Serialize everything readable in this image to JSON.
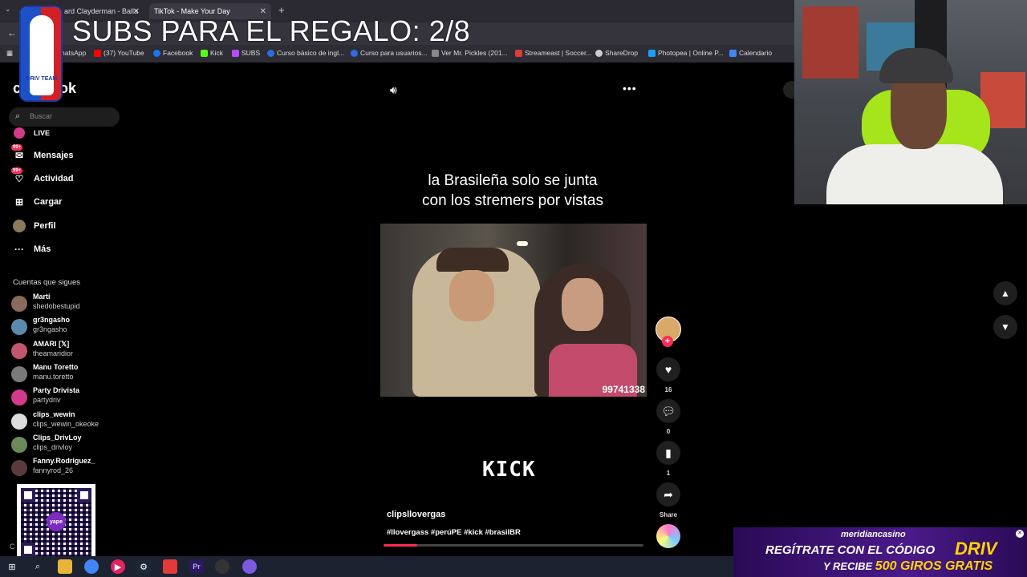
{
  "overlay": {
    "title": "SUBS PARA EL REGALO: 2/8",
    "logo_text": "DRIV TEAM"
  },
  "browser": {
    "tabs": [
      {
        "label": "ard Clayderman - Balla"
      },
      {
        "label": "TikTok - Make Your Day"
      }
    ],
    "new_tab": "+",
    "bookmarks": [
      {
        "label": "hatsApp",
        "color": "#25d366"
      },
      {
        "label": "(37) YouTube",
        "color": "#ff0000"
      },
      {
        "label": "Facebook",
        "color": "#1877f2"
      },
      {
        "label": "Kick",
        "color": "#53fc18"
      },
      {
        "label": "SUBS",
        "color": "#b44cff"
      },
      {
        "label": "Curso básico de ingl...",
        "color": "#2d6cdf"
      },
      {
        "label": "Curso para usuarios...",
        "color": "#2d6cdf"
      },
      {
        "label": "Ver Mr. Pickles (201...",
        "color": "#888888"
      },
      {
        "label": "Streameast | Soccer...",
        "color": "#e03a3a"
      },
      {
        "label": "ShareDrop",
        "color": "#cccccc"
      },
      {
        "label": "Photopea | Online P...",
        "color": "#18a0fb"
      },
      {
        "label": "Calendario",
        "color": "#4285f4"
      }
    ]
  },
  "sidebar": {
    "brand": "ok",
    "search_placeholder": "Buscar",
    "nav": [
      {
        "label": "LIVE",
        "badge": "",
        "icon": "live-icon"
      },
      {
        "label": "Mensajes",
        "badge": "99+",
        "icon": "messages-icon"
      },
      {
        "label": "Actividad",
        "badge": "99+",
        "icon": "activity-icon"
      },
      {
        "label": "Cargar",
        "badge": "",
        "icon": "upload-icon"
      },
      {
        "label": "Perfil",
        "badge": "",
        "icon": "profile-icon"
      },
      {
        "label": "Más",
        "badge": "",
        "icon": "more-icon"
      }
    ],
    "following_title": "Cuentas que sigues",
    "following": [
      {
        "name": "Marti",
        "handle": "shedobestupid",
        "color": "#8a6a5a"
      },
      {
        "name": "gr3ngasho",
        "handle": "gr3ngasho",
        "color": "#5a8ab0"
      },
      {
        "name": "AMARI [𝕏]",
        "handle": "theamaridior",
        "color": "#c2566e"
      },
      {
        "name": "Manu Toretto",
        "handle": "manu.toretto",
        "color": "#7a7a7a"
      },
      {
        "name": "Party Drivista",
        "handle": "partydriv",
        "color": "#d23a8a"
      },
      {
        "name": "clips_wewin",
        "handle": "clips_wewin_okeoke",
        "color": "#dddddd"
      },
      {
        "name": "Clips_DrivLoy",
        "handle": "clips_drivloy",
        "color": "#6a8a5a"
      },
      {
        "name": "Fanny.Rodriguez_",
        "handle": "fannyrod_26",
        "color": "#5a3a3a"
      }
    ],
    "qr_label": "yape",
    "bottom_text": "C"
  },
  "video": {
    "caption_line1": "la Brasileña solo se junta",
    "caption_line2": "con los stremers por vistas",
    "overlay_number": "99741338",
    "watermark": "KICK",
    "author": "clipsllovergas",
    "hashtags": "#llovergass #perúPE #kick #brasilBR",
    "progress": 0.13
  },
  "actions": {
    "likes": "16",
    "comments": "0",
    "saves": "1",
    "share_label": "Share"
  },
  "casino": {
    "brand": "meridiancasino",
    "line1": "REGÍTRATE CON EL CÓDIGO",
    "code": "DRIV",
    "line2_prefix": "Y RECIBE",
    "line2_highlight": "500 GIROS GRATIS"
  }
}
